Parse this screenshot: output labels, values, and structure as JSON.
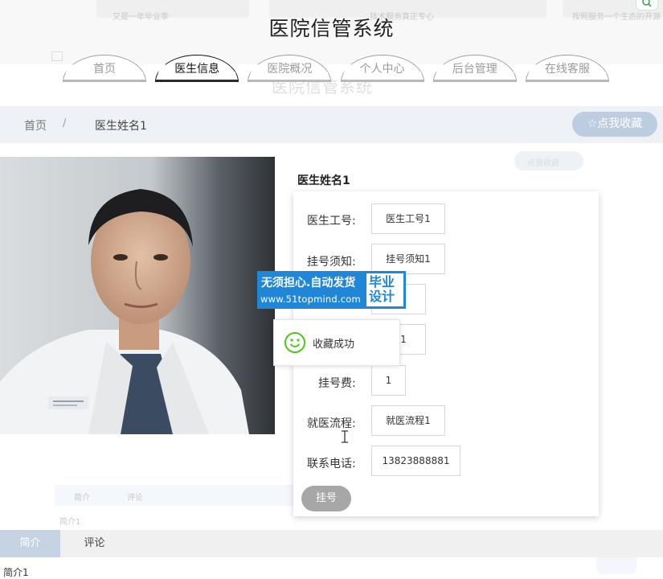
{
  "app": {
    "title": "医院信管系统"
  },
  "nav": {
    "tabs": [
      {
        "label": "首页"
      },
      {
        "label": "医生信息"
      },
      {
        "label": "医院概况"
      },
      {
        "label": "个人中心"
      },
      {
        "label": "后台管理"
      },
      {
        "label": "在线客服"
      }
    ],
    "active_index": 1
  },
  "breadcrumb": {
    "home": "首页",
    "separator": "/",
    "current": "医生姓名1"
  },
  "favorite_button": {
    "icon": "star-outline-icon",
    "label": "点我收藏"
  },
  "doctor": {
    "name": "医生姓名1",
    "fields": [
      {
        "label": "医生工号:",
        "value": "医生工号1"
      },
      {
        "label": "挂号须知:",
        "value": "挂号须知1"
      },
      {
        "label": "",
        "value": "1"
      },
      {
        "label": "",
        "value": "你1"
      },
      {
        "label": "挂号费:",
        "value": "1"
      },
      {
        "label": "就医流程:",
        "value": "就医流程1"
      },
      {
        "label": "联系电话:",
        "value": "13823888881"
      }
    ],
    "book_button": "挂号"
  },
  "watermark": {
    "line1": "无须担心.自动发货",
    "line2": "www.51topmind.com",
    "badge_line1": "毕业",
    "badge_line2": "设计"
  },
  "toast": {
    "icon": "smile-icon",
    "text": "收藏成功"
  },
  "detail_tabs": [
    {
      "label": "简介"
    },
    {
      "label": "评论"
    }
  ],
  "intro": {
    "text": "简介1"
  },
  "ghost": {
    "card1": "又是一年毕业季",
    "card2": "技术服务真正专心",
    "card3": "按照服务一个生态的开源",
    "title": "医院信管系统",
    "nav": [
      "首页",
      "医生信息",
      "医院概况",
      "个人中心",
      "后台管理",
      "在线客服"
    ],
    "crumb_home": "首页",
    "crumb_current": "医生姓名1",
    "fav": "点我收藏",
    "name": "医生姓名1",
    "label1": "医生工号:",
    "value1": "医生工号1",
    "label_fee": "挂号费:",
    "label_flow": "就医流程:",
    "value_flow": "就医流程1",
    "label_phone": "联系电话:",
    "value_phone": "13823888881",
    "tab1": "简介",
    "tab2": "评论",
    "intro": "简介1"
  },
  "colors": {
    "accent": "#1f86d8",
    "fav_button": "#bccde2",
    "book_button": "#a7a7a7",
    "tab_active": "#c6d3e2",
    "crumb_bar": "#eef2f7"
  }
}
